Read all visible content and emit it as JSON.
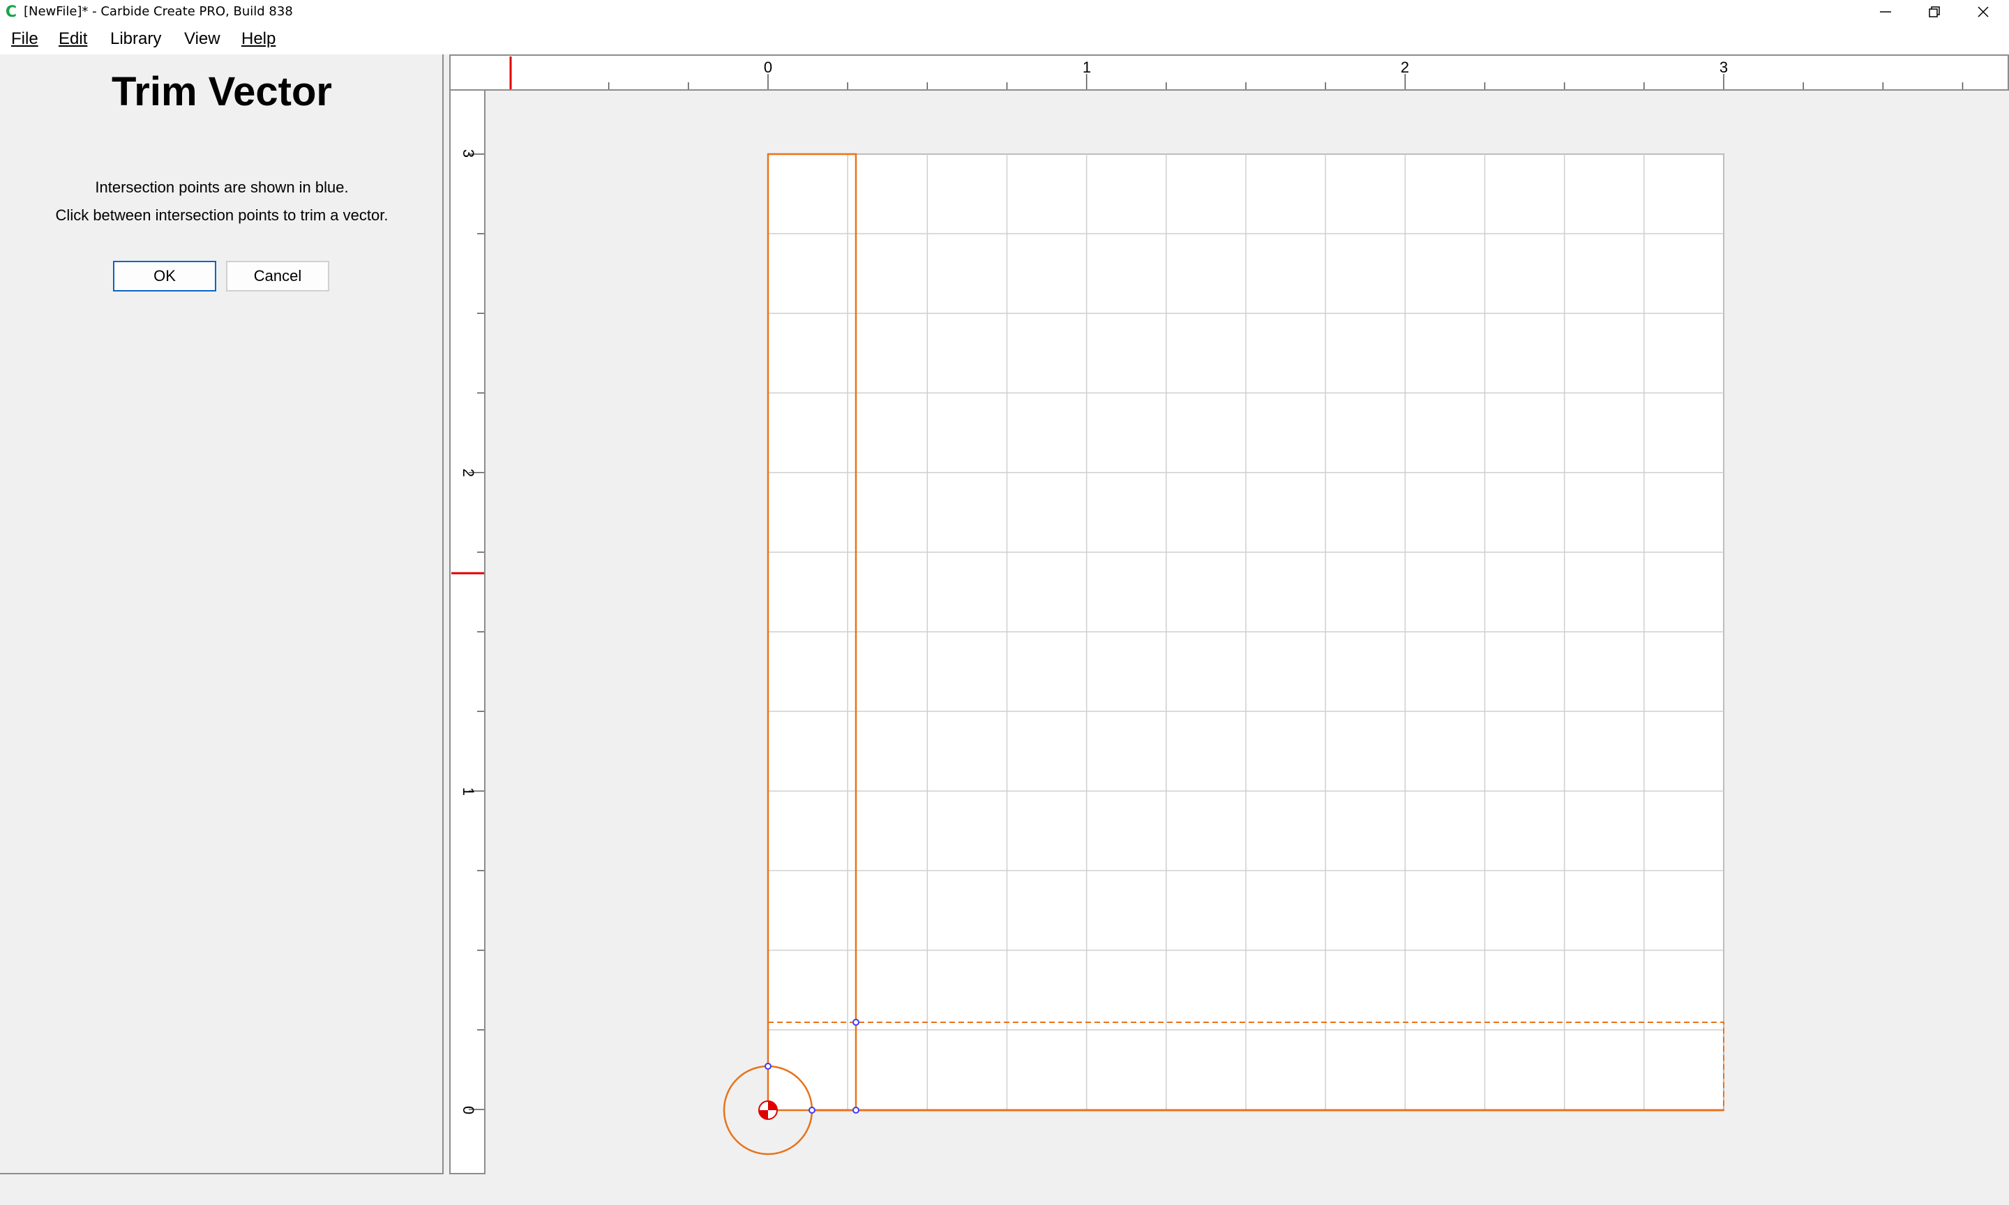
{
  "window": {
    "title": "[NewFile]* - Carbide Create PRO, Build 838",
    "app_icon_glyph": "C",
    "controls": [
      "minimize-icon",
      "restore-icon",
      "close-icon"
    ]
  },
  "menubar": {
    "items": [
      {
        "label": "File"
      },
      {
        "label": "Edit"
      },
      {
        "label": "Library"
      },
      {
        "label": "View"
      },
      {
        "label": "Help"
      }
    ]
  },
  "panel": {
    "title": "Trim Vector",
    "line1": "Intersection points are shown in blue.",
    "line2": "Click between intersection points to trim a vector.",
    "ok_label": "OK",
    "cancel_label": "Cancel"
  },
  "rulers": {
    "horizontal_labels": [
      "0",
      "1",
      "2",
      "3"
    ],
    "vertical_labels": [
      "3",
      "2",
      "1",
      "0"
    ]
  },
  "colors": {
    "vector": "#e8731a",
    "intersection": "#3a3aff",
    "grid": "#cfcfcf",
    "cursor_marker": "#e00000",
    "ok_border": "#0a64c8"
  }
}
